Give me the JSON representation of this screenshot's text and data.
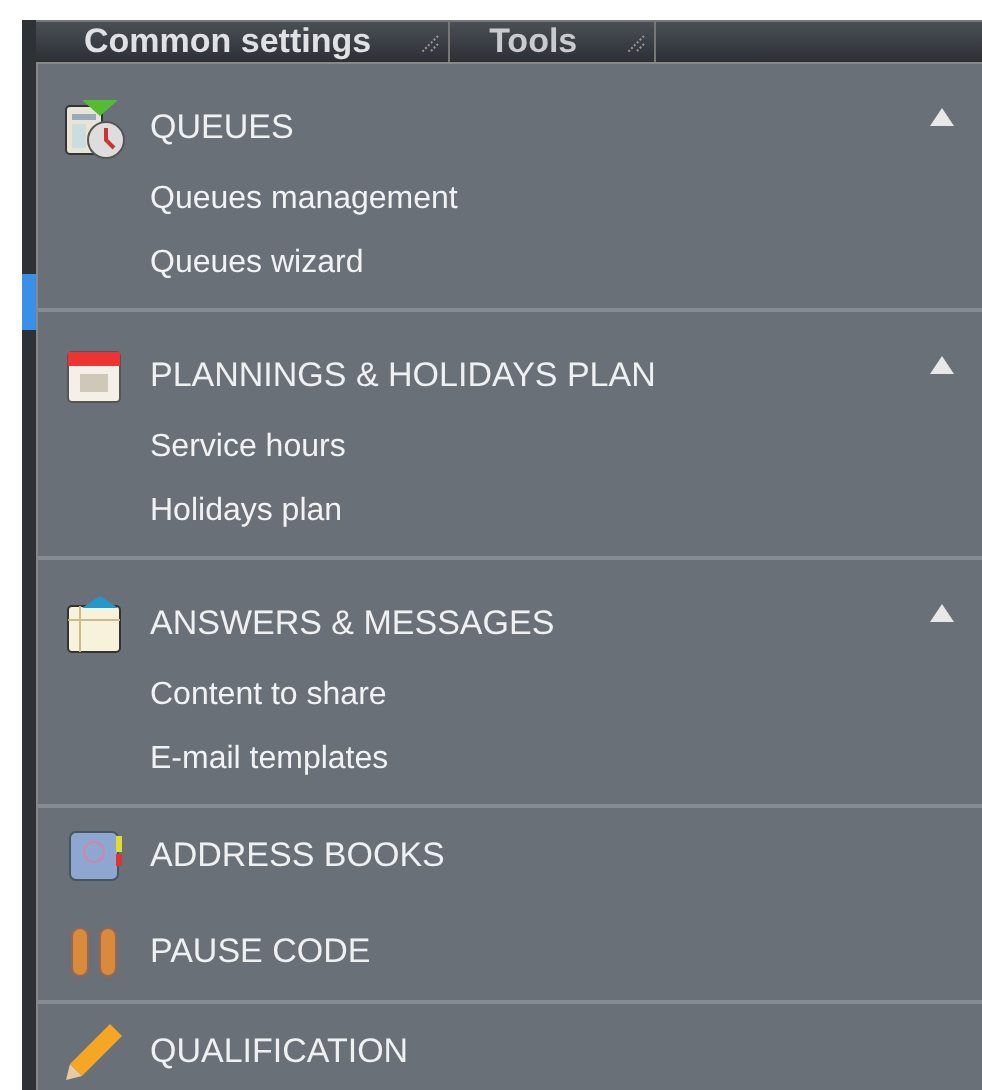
{
  "tabs": [
    {
      "label": "Common settings",
      "selected": true
    },
    {
      "label": "Tools",
      "selected": false
    }
  ],
  "menu": {
    "blocks": [
      [
        {
          "kind": "group",
          "title": "QUEUES",
          "expanded": true,
          "items": [
            "Queues management",
            "Queues wizard"
          ]
        }
      ],
      [
        {
          "kind": "group",
          "title": "PLANNINGS & HOLIDAYS PLAN",
          "expanded": true,
          "items": [
            "Service hours",
            "Holidays plan"
          ]
        }
      ],
      [
        {
          "kind": "group",
          "title": "ANSWERS & MESSAGES",
          "expanded": true,
          "items": [
            "Content to share",
            "E-mail templates"
          ]
        }
      ],
      [
        {
          "kind": "entry",
          "title": "ADDRESS BOOKS"
        },
        {
          "kind": "entry",
          "title": "PAUSE CODE"
        }
      ],
      [
        {
          "kind": "entry",
          "title": "QUALIFICATION"
        }
      ]
    ]
  }
}
